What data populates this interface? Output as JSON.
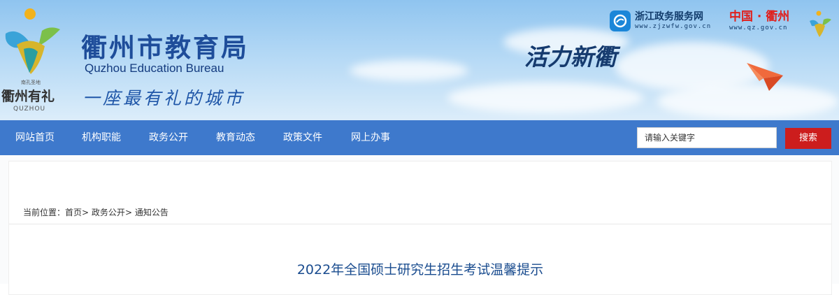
{
  "header": {
    "logo_text": "衢州有礼",
    "logo_small_text": "南孔圣地",
    "logo_pinyin": "QUZHOU",
    "title": "衢州市教育局",
    "subtitle": "Quzhou Education Bureau",
    "slogan": "一座最有礼的城市",
    "vitality": "活力新衢",
    "zj_link": {
      "name": "浙江政务服务网",
      "url": "www.zjzwfw.gov.cn",
      "icon": "zj-service-icon"
    },
    "qz_link": {
      "name": "中国 · 衢州",
      "url": "www.qz.gov.cn"
    },
    "colors": {
      "title": "#1e4d9a",
      "qz_red": "#e0201d",
      "sky_top": "#8fc4ef"
    }
  },
  "nav": {
    "items": [
      {
        "label": "网站首页"
      },
      {
        "label": "机构职能"
      },
      {
        "label": "政务公开"
      },
      {
        "label": "教育动态"
      },
      {
        "label": "政策文件"
      },
      {
        "label": "网上办事"
      }
    ],
    "search": {
      "placeholder": "请输入关键字",
      "button_label": "搜索"
    },
    "colors": {
      "bar": "#3e79cc",
      "button": "#cc1d1d"
    }
  },
  "breadcrumb": {
    "prefix": "当前位置：",
    "items": [
      {
        "label": "首页",
        "sep": ">"
      },
      {
        "label": "政务公开",
        "sep": ">"
      },
      {
        "label": "通知公告",
        "sep": ""
      }
    ]
  },
  "article": {
    "title": "2022年全国硕士研究生招生考试温馨提示"
  }
}
